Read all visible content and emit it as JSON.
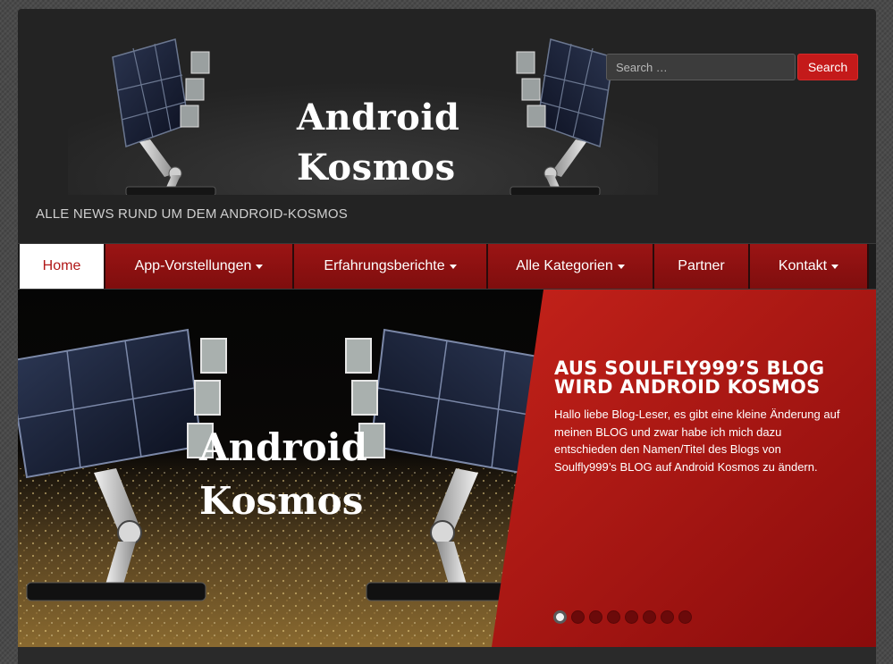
{
  "site": {
    "logo_title": "Android Kosmos",
    "tagline": "ALLE NEWS RUND UM DEM ANDROID-KOSMOS"
  },
  "search": {
    "placeholder": "Search …",
    "button_label": "Search"
  },
  "nav": {
    "items": [
      {
        "label": "Home",
        "active": true,
        "has_dropdown": false
      },
      {
        "label": "App-Vorstellungen",
        "active": false,
        "has_dropdown": true
      },
      {
        "label": "Erfahrungsberichte",
        "active": false,
        "has_dropdown": true
      },
      {
        "label": "Alle Kategorien",
        "active": false,
        "has_dropdown": true
      },
      {
        "label": "Partner",
        "active": false,
        "has_dropdown": false
      },
      {
        "label": "Kontakt",
        "active": false,
        "has_dropdown": true
      }
    ]
  },
  "slider": {
    "image_title": "Android Kosmos",
    "title_line1": "AUS SOULFLY999’S BLOG",
    "title_line2": "WIRD ANDROID KOSMOS",
    "text": "Hallo liebe Blog-Leser,   es gibt eine kleine Änderung auf meinen BLOG und zwar habe ich mich dazu entschieden den Namen/Titel des Blogs von Soulfly999’s BLOG auf Android Kosmos zu ändern.",
    "slide_count": 8,
    "active_slide": 1
  },
  "colors": {
    "accent_red": "#c41a1a",
    "nav_red": "#8d1111",
    "header_bg": "#232323"
  }
}
